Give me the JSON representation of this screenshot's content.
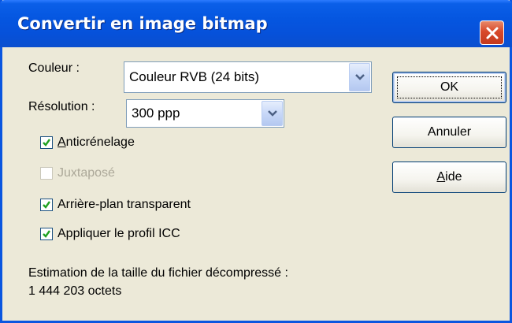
{
  "window": {
    "title": "Convertir en image bitmap"
  },
  "color": {
    "label": "Couleur :",
    "selected": "Couleur RVB (24 bits)"
  },
  "resolution": {
    "label": "Résolution :",
    "selected": "300 ppp"
  },
  "options": {
    "antialiasing": {
      "label_first": "A",
      "label_rest": "nticrénelage",
      "checked": true,
      "enabled": true
    },
    "tiled": {
      "label": "Juxtaposé",
      "checked": false,
      "enabled": false
    },
    "transparent_bg": {
      "label": "Arrière-plan transparent",
      "checked": true,
      "enabled": true
    },
    "icc_profile": {
      "label": "Appliquer le profil ICC",
      "checked": true,
      "enabled": true
    }
  },
  "estimate": {
    "label": "Estimation de la taille du fichier décompressé :",
    "value": "1 444 203 octets"
  },
  "buttons": {
    "ok": "OK",
    "cancel": "Annuler",
    "help_first": "A",
    "help_rest": "ide"
  },
  "colors": {
    "titlebar": "#0556E0",
    "dialog_bg": "#ECE9D8",
    "checkmark": "#21A121",
    "close_button": "#D8482A"
  },
  "icons": {
    "close": "close-icon",
    "dropdown": "chevron-down-icon",
    "check": "checkmark-icon"
  }
}
